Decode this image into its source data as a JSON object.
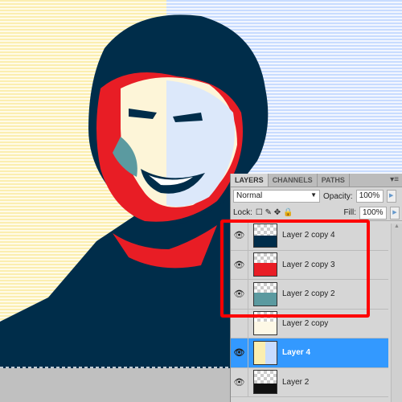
{
  "colors": {
    "navy": "#002d4a",
    "red": "#e81d25",
    "teal": "#5b9aa0",
    "cream": "#fdf5d8",
    "yellow_stripe": "#fbeeb0",
    "blue_stripe": "#c8dcff",
    "highlight": "#ff0000",
    "selected": "#3399ff"
  },
  "panel": {
    "tabs": [
      "LAYERS",
      "CHANNELS",
      "PATHS"
    ],
    "menu_icon": "panel-menu-icon",
    "blend_mode": "Normal",
    "opacity_label": "Opacity:",
    "opacity": "100%",
    "lock_label": "Lock:",
    "fill_label": "Fill:",
    "fill": "100%",
    "layers": [
      {
        "name": "Layer 2 copy 4",
        "visible": true,
        "selected": false
      },
      {
        "name": "Layer 2 copy 3",
        "visible": true,
        "selected": false
      },
      {
        "name": "Layer 2 copy 2",
        "visible": true,
        "selected": false
      },
      {
        "name": "Layer 2 copy",
        "visible": false,
        "selected": false
      },
      {
        "name": "Layer 4",
        "visible": true,
        "selected": true
      },
      {
        "name": "Layer 2",
        "visible": true,
        "selected": false
      }
    ]
  }
}
